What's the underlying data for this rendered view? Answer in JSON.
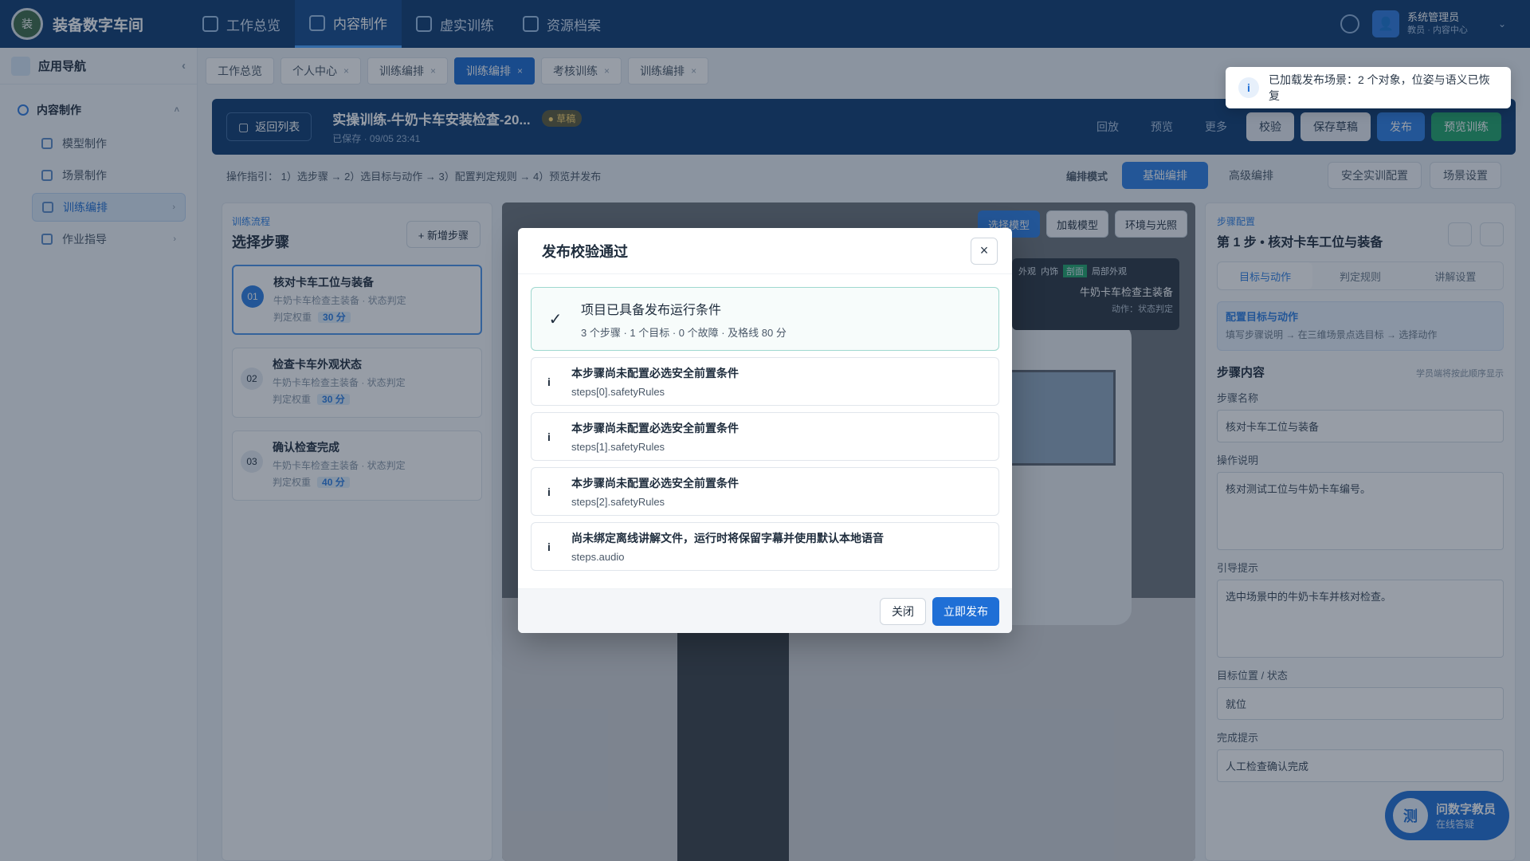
{
  "topbar": {
    "logo_text": "装",
    "app_title": "装备数字车间",
    "nav": [
      {
        "label": "工作总览",
        "icon": "dashboard-icon"
      },
      {
        "label": "内容制作",
        "icon": "gear-icon"
      },
      {
        "label": "虚实训练",
        "icon": "cube-icon"
      },
      {
        "label": "资源档案",
        "icon": "refresh-icon"
      }
    ],
    "user_name": "系统管理员",
    "user_sub": "教员 · 内容中心"
  },
  "sidebar": {
    "title": "应用导航",
    "group": "内容制作",
    "items": [
      {
        "label": "模型制作"
      },
      {
        "label": "场景制作"
      },
      {
        "label": "训练编排"
      },
      {
        "label": "作业指导"
      }
    ]
  },
  "tabs": [
    {
      "label": "工作总览"
    },
    {
      "label": "个人中心"
    },
    {
      "label": "训练编排"
    },
    {
      "label": "训练编排"
    },
    {
      "label": "考核训练"
    },
    {
      "label": "训练编排"
    }
  ],
  "project": {
    "back_label": "返回列表",
    "title": "实操训练-牛奶卡车安装检查-20...",
    "badge": "● 草稿",
    "subtitle": "已保存 · 09/05 23:41",
    "actions": [
      "回放",
      "预览",
      "更多",
      "校验",
      "保存草稿",
      "发布",
      "预览训练"
    ]
  },
  "hint": {
    "steps": "操作指引：  1）选步骤 → 2）选目标与动作 → 3）配置判定规则 → 4）预览并发布",
    "mode_label": "编排模式",
    "mode_on": "基础编排",
    "mode_off": "高级编排",
    "tools": [
      "安全实训配置",
      "场景设置"
    ]
  },
  "steps_panel": {
    "kicker": "训练流程",
    "title": "选择步骤",
    "add_label": "+ 新增步骤",
    "steps": [
      {
        "num": "01",
        "name": "核对卡车工位与装备",
        "desc": "牛奶卡车检查主装备 · 状态判定",
        "score_label": "判定权重",
        "score": "30 分"
      },
      {
        "num": "02",
        "name": "检查卡车外观状态",
        "desc": "牛奶卡车检查主装备 · 状态判定",
        "score_label": "判定权重",
        "score": "30 分"
      },
      {
        "num": "03",
        "name": "确认检查完成",
        "desc": "牛奶卡车检查主装备 · 状态判定",
        "score_label": "判定权重",
        "score": "40 分"
      }
    ]
  },
  "viewport": {
    "tools": [
      "选择模型",
      "加载模型",
      "环境与光照"
    ],
    "overlay_tabs": [
      "外观",
      "内饰",
      "剖面",
      "局部外观"
    ],
    "overlay_title": "牛奶卡车检查主装备",
    "overlay_sub": "动作：状态判定"
  },
  "config": {
    "kicker": "步骤配置",
    "title": "第 1 步 • 核对卡车工位与装备",
    "tabs": [
      "目标与动作",
      "判定规则",
      "讲解设置"
    ],
    "tip_title": "配置目标与动作",
    "tip_body": "填写步骤说明 → 在三维场景点选目标 → 选择动作",
    "section_title": "步骤内容",
    "section_note": "学员端将按此顺序显示",
    "fields": [
      {
        "label": "步骤名称",
        "value": "核对卡车工位与装备"
      },
      {
        "label": "操作说明",
        "value": "核对测试工位与牛奶卡车编号。"
      },
      {
        "label": "引导提示",
        "value": "选中场景中的牛奶卡车并核对检查。"
      },
      {
        "label": "目标位置 / 状态",
        "value": "就位"
      },
      {
        "label": "完成提示",
        "value": "人工检查确认完成"
      }
    ]
  },
  "assistant": {
    "avatar": "测",
    "title": "问数字教员",
    "status": "在线答疑"
  },
  "toast": {
    "icon": "i",
    "message": "已加载发布场景：2 个对象，位姿与语义已恢复"
  },
  "modal": {
    "title": "发布校验通过",
    "close_glyph": "×",
    "ok_title": "项目已具备发布运行条件",
    "ok_sub": "3 个步骤 · 1 个目标 · 0 个故障 · 及格线 80 分",
    "issues": [
      {
        "msg": "本步骤尚未配置必选安全前置条件",
        "path": "steps[0].safetyRules"
      },
      {
        "msg": "本步骤尚未配置必选安全前置条件",
        "path": "steps[1].safetyRules"
      },
      {
        "msg": "本步骤尚未配置必选安全前置条件",
        "path": "steps[2].safetyRules"
      },
      {
        "msg": "尚未绑定离线讲解文件，运行时将保留字幕并使用默认本地语音",
        "path": "steps.audio"
      }
    ],
    "close_label": "关闭",
    "publish_label": "立即发布"
  }
}
